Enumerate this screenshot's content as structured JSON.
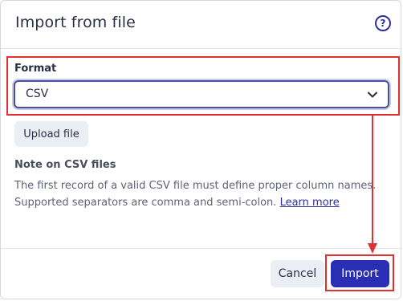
{
  "dialog": {
    "title": "Import from file",
    "help_icon": "help-circle-icon",
    "help_symbol": "?"
  },
  "format": {
    "label": "Format",
    "selected": "CSV"
  },
  "upload": {
    "label": "Upload file"
  },
  "note": {
    "title": "Note on CSV files",
    "text": "The first record of a valid CSV file must define proper column names. Supported separators are comma and semi-colon. ",
    "link": "Learn more"
  },
  "footer": {
    "cancel_label": "Cancel",
    "import_label": "Import"
  },
  "colors": {
    "accent": "#2a2eb5",
    "annotation": "#e0302f"
  }
}
